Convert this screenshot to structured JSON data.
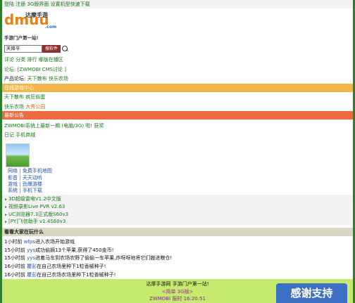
{
  "topbar": {
    "home": "登陆",
    "register": "注册",
    "view3g": "3G版界面",
    "settings": "设置机型快速下载"
  },
  "logo": {
    "brand": "dmuu",
    "brand_cn": "达摩手游",
    "domain": ".com"
  },
  "slogan": "手游门户第一站!",
  "search": {
    "value": "天降平",
    "button": "搜软件"
  },
  "nav1": [
    "评论",
    "分类",
    "排行",
    "哪版在播区"
  ],
  "nav2": {
    "prefix": "论坛:",
    "link": "[ZWMOBI CMS讨论 ]"
  },
  "products": {
    "label": "产品论坛:",
    "links": [
      "天下散布",
      "快乐农场"
    ]
  },
  "center_bar": "在线游戏中心",
  "center_row1": {
    "a": "天下散布",
    "b": "疯狂偷蛋"
  },
  "center_row2": {
    "a": "快乐农场",
    "b": "大秀公园"
  },
  "notice_bar": "最新公告",
  "notice_row": {
    "text": "ZWMOBI系统上最新一期 (电脑/3G) 啦!",
    "link": "获奖"
  },
  "diary_row": [
    "日记",
    "手机商城"
  ],
  "categories": [
    {
      "key": "网络",
      "value": "免费手机地图"
    },
    {
      "key": "影音",
      "value": "天天动听"
    },
    {
      "key": "游戏",
      "value": "劲爆游楼"
    },
    {
      "key": "系统",
      "value": "手机下载"
    }
  ],
  "softs": [
    "3D超级雷电V1.2中文版",
    "视频录影Live PVR v2.63",
    "UC浏览器7.3正式版S60v3",
    "[PY]飞信助手 v1.4S60v3"
  ],
  "chat_bar": "看看大家在玩什么",
  "feed": [
    {
      "time": "1小时前",
      "user": "wfps",
      "text": "进入农场开始游戏"
    },
    {
      "time": "15小时前",
      "user": "yys",
      "text": "成功偷摘13个苹果,获得了450金币!"
    },
    {
      "time": "15小时前",
      "user": "yys",
      "text": "进着马车到农场农野了偷偷一车苹果,炸呀呀地将它们搬进粮仓!"
    },
    {
      "time": "16小时前",
      "user": "瞿彭",
      "text": "在自己农场里种下1粒香椒种子!"
    },
    {
      "time": "16小时前",
      "user": "瞿彭",
      "text": "在自己农场农场里种下1粒香椒种子!"
    }
  ],
  "footer": {
    "line1": "达摩手游网 手游门户第一站!",
    "line2": "<简单 3G版>",
    "line3": "ZWMOBI 报时 16:20:51"
  },
  "thanks_label": "感谢支持"
}
